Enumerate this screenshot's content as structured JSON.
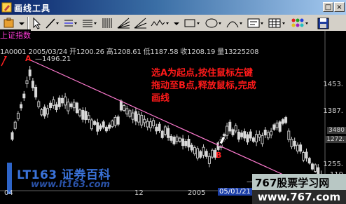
{
  "window": {
    "title": "画线工具",
    "close_label": "×",
    "restore_label": "□"
  },
  "toolbar": {
    "tools": [
      "pointer-tool",
      "segment-tool",
      "horizontal-line-tool",
      "parallel-lines-tool",
      "vertical-lines-tool",
      "fan-lines-tool",
      "angle-tool",
      "rectangle-tool",
      "ellipse-tool",
      "arc-tool",
      "text-tool",
      "grid-tool",
      "palette-tool",
      "save-tool"
    ]
  },
  "chart": {
    "index_name": "上证指数",
    "info": {
      "code": "1A0001",
      "date": "2005/03/24",
      "open": "开1200.26",
      "high": "高1208.61",
      "low": "低1187.58",
      "close": "收1208.19",
      "volume": "量13225208"
    },
    "high_marker": "—1496.21",
    "low_marker": "—11",
    "point_a": "A",
    "point_b": "B",
    "instruction_lines": [
      "选A为起点,按住鼠标左键",
      "拖动至B点,释放鼠标,完成",
      "画线"
    ],
    "y_axis": [
      "1453.",
      "1387.",
      "1321.",
      "1255.",
      "119"
    ],
    "price_box_1": "3480",
    "price_box_2": "1272.",
    "x_axis": [
      "04",
      "12",
      "2005"
    ],
    "date_highlight": "05/01/21",
    "brand": {
      "name_en": "LT163",
      "name_cn": "证券百科",
      "url": "www.lt163.com"
    },
    "watermark": {
      "main": "767股票学习网",
      "url": "www.767.com"
    }
  },
  "colors": {
    "up": "#d8d8d8",
    "down": "#c8c8c8",
    "line": "#ff7ad0",
    "title_bar": "#0a246a"
  }
}
